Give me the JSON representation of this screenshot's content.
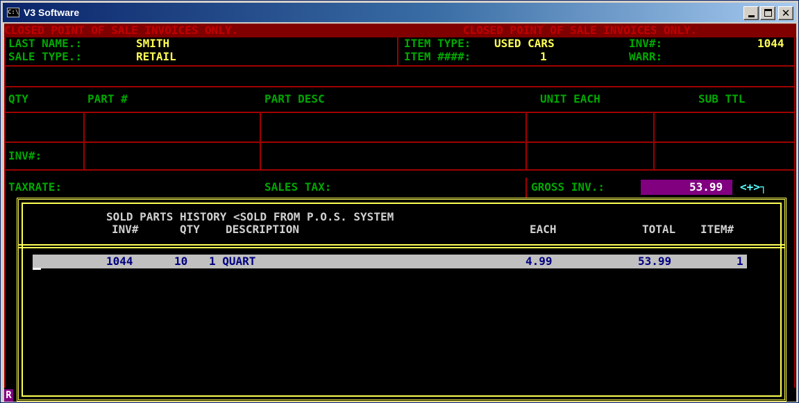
{
  "window": {
    "title": "V3 Software",
    "icon": "console-icon",
    "controls": [
      "minimize-button",
      "maximize-button",
      "close-button"
    ]
  },
  "banner": {
    "left": "CLOSED POINT OF SALE INVOICES ONLY.",
    "right": "CLOSED POINT OF SALE INVOICES ONLY."
  },
  "header": {
    "last_name_label": "LAST NAME.:",
    "last_name_value": "SMITH",
    "sale_type_label": "SALE TYPE.:",
    "sale_type_value": "RETAIL",
    "item_type_label": "ITEM TYPE:",
    "item_type_value": "USED CARS",
    "item_num_label": "ITEM ####:",
    "item_num_value": "1",
    "inv_label": "INV#:",
    "inv_value": "1044",
    "warr_label": "WARR:"
  },
  "grid": {
    "columns": [
      "QTY",
      "PART #",
      "PART DESC",
      "UNIT EACH",
      "SUB TTL"
    ],
    "inv_label": "INV#:",
    "taxrate_label": "TAXRATE:",
    "sales_tax_label": "SALES TAX:",
    "gross_inv_label": "GROSS INV.:",
    "gross_inv_value": "53.99",
    "plus_indicator": "<+>┐"
  },
  "history": {
    "title": "SOLD PARTS HISTORY <SOLD FROM P.O.S. SYSTEM",
    "columns": {
      "inv": "INV#",
      "qty": "QTY",
      "description": "DESCRIPTION",
      "each": "EACH",
      "total": "TOTAL",
      "item": "ITEM#"
    },
    "rows": [
      {
        "inv": "1044",
        "qty": "10",
        "description": "1 QUART",
        "each": "4.99",
        "total": "53.99",
        "item": "1"
      }
    ]
  },
  "status": {
    "corner_glyph": "R"
  },
  "colors": {
    "banner_bg": "#800000",
    "label": "#00a800",
    "value": "#ffff55",
    "grid_line": "#a00000",
    "highlight": "#800080",
    "popup_border": "#ffff55",
    "selected_row": "#c0c0c0"
  }
}
